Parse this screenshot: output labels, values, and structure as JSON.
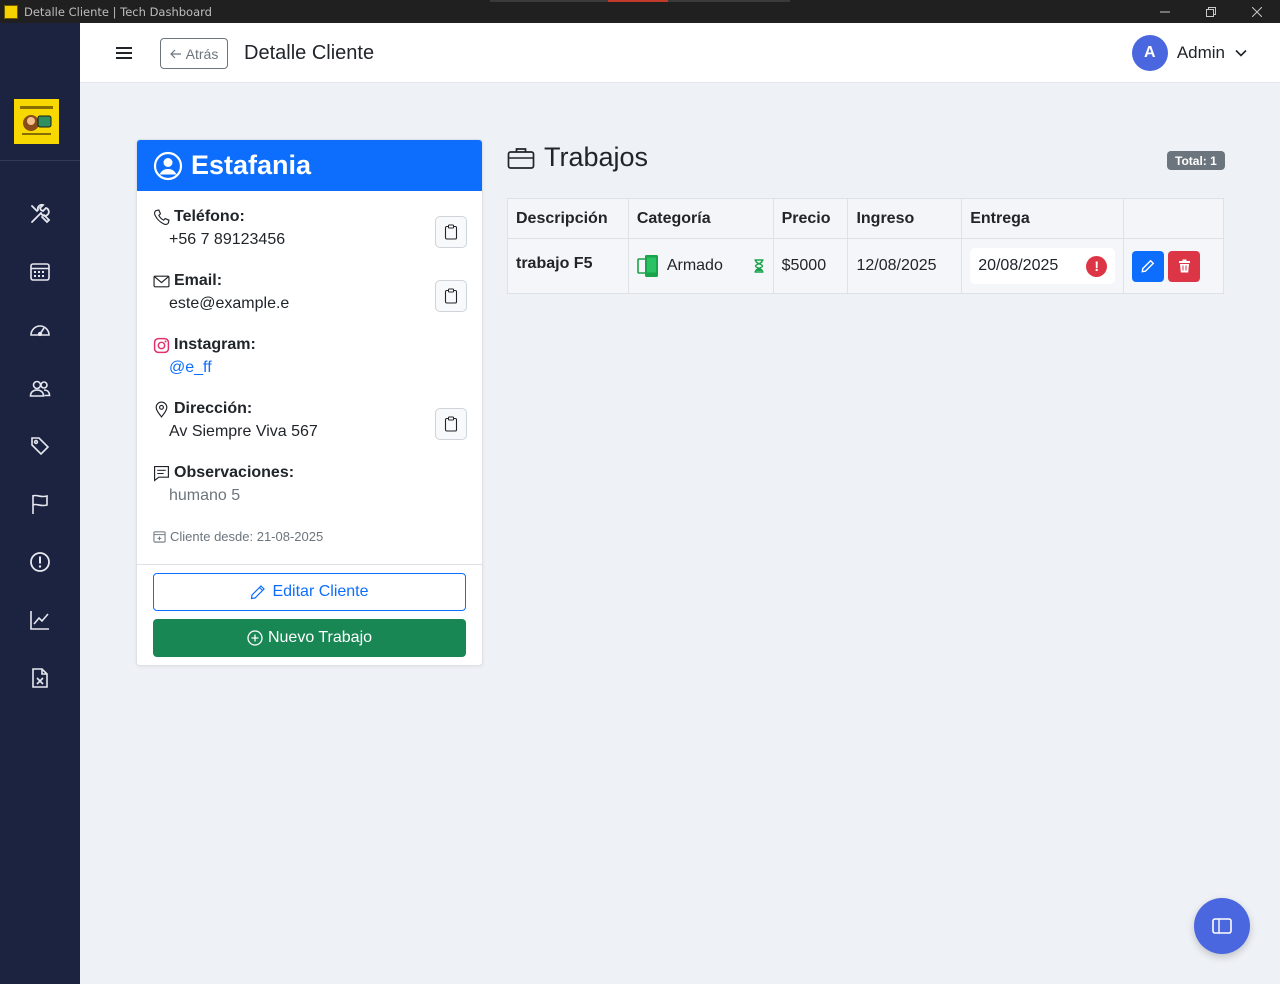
{
  "window": {
    "title": "Detalle Cliente | Tech Dashboard"
  },
  "header": {
    "back_label": "Atrás",
    "title": "Detalle Cliente",
    "user": {
      "initial": "A",
      "name": "Admin"
    }
  },
  "sidebar": {
    "logo_alt": "Servicio Técnico",
    "items": [
      {
        "icon": "tools-icon"
      },
      {
        "icon": "calendar-icon"
      },
      {
        "icon": "speedometer-icon"
      },
      {
        "icon": "people-icon"
      },
      {
        "icon": "tags-icon"
      },
      {
        "icon": "flag-icon"
      },
      {
        "icon": "exclamation-circle-icon"
      },
      {
        "icon": "graph-icon"
      },
      {
        "icon": "excel-file-icon"
      }
    ]
  },
  "client": {
    "name": "Estafania",
    "phone_label": "Teléfono:",
    "phone": "+56 7 89123456",
    "email_label": "Email:",
    "email": "este@example.e",
    "instagram_label": "Instagram:",
    "instagram": "@e_ff",
    "address_label": "Dirección:",
    "address": "Av Siempre Viva 567",
    "notes_label": "Observaciones:",
    "notes": "humano 5",
    "since": "Cliente desde: 21-08-2025",
    "edit_label": "Editar Cliente",
    "new_job_label": "Nuevo Trabajo"
  },
  "jobs": {
    "title": "Trabajos",
    "total": "Total: 1",
    "columns": [
      "Descripción",
      "Categoría",
      "Precio",
      "Ingreso",
      "Entrega",
      ""
    ],
    "rows": [
      {
        "description": "trabajo F5",
        "category": "Armado",
        "price": "$5000",
        "received": "12/08/2025",
        "delivery": "20/08/2025",
        "status_icon": "hourglass-icon"
      }
    ]
  },
  "colors": {
    "primary": "#0d6efd",
    "success": "#198754",
    "danger": "#dc3545",
    "sidebar": "#1c2340",
    "avatar": "#4a67e0"
  }
}
